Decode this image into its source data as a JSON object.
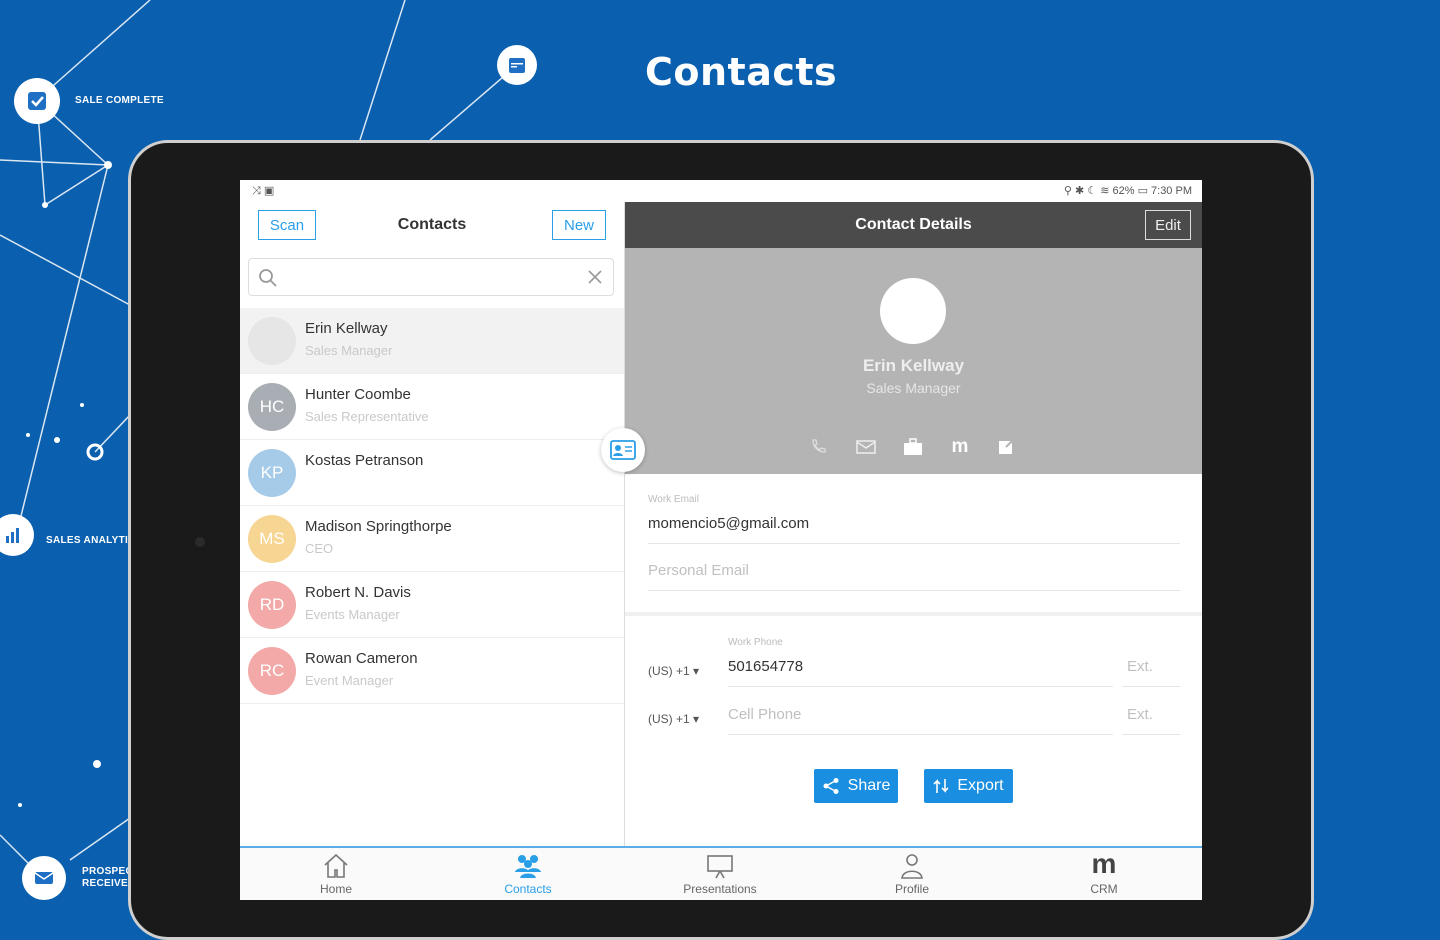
{
  "hero": {
    "title": "Contacts"
  },
  "nodes": [
    {
      "label": "SALE COMPLETE"
    },
    {
      "label": "SALES ANALYTI"
    },
    {
      "label": "PROSPEC RECEIVE"
    }
  ],
  "status_bar": {
    "left": "⤨ ▣",
    "right": "⚲ ✱ ☾ ≋ 62% ▭ 7:30 PM"
  },
  "left_panel": {
    "scan_label": "Scan",
    "title": "Contacts",
    "new_label": "New",
    "search": {
      "placeholder": "",
      "value": ""
    },
    "contacts": [
      {
        "initials": "",
        "name": "Erin Kellway",
        "role": "Sales Manager",
        "color": "#e6e6e6",
        "selected": true
      },
      {
        "initials": "HC",
        "name": "Hunter Coombe",
        "role": "Sales Representative",
        "color": "#a9adb4"
      },
      {
        "initials": "KP",
        "name": "Kostas Petranson",
        "role": "",
        "color": "#a6cbe8"
      },
      {
        "initials": "MS",
        "name": "Madison Springthorpe",
        "role": "CEO",
        "color": "#f7d592"
      },
      {
        "initials": "RD",
        "name": "Robert N. Davis",
        "role": "Events Manager",
        "color": "#f2a9a8"
      },
      {
        "initials": "RC",
        "name": "Rowan Cameron",
        "role": "Event Manager",
        "color": "#f2a9a8"
      }
    ]
  },
  "right_panel": {
    "title": "Contact Details",
    "edit_label": "Edit",
    "profile": {
      "name": "Erin Kellway",
      "role": "Sales Manager"
    },
    "work_email_label": "Work Email",
    "work_email": "momencio5@gmail.com",
    "personal_email_placeholder": "Personal Email",
    "work_phone_label": "Work Phone",
    "country_code_1": "(US) +1 ▾",
    "work_phone": "501654778",
    "ext_1": "Ext.",
    "country_code_2": "(US) +1 ▾",
    "cell_phone_placeholder": "Cell Phone",
    "ext_2": "Ext.",
    "share_label": "Share",
    "export_label": "Export"
  },
  "bottom_nav": [
    {
      "label": "Home",
      "icon": "home-icon",
      "active": false
    },
    {
      "label": "Contacts",
      "icon": "contacts-icon",
      "active": true
    },
    {
      "label": "Presentations",
      "icon": "presentation-icon",
      "active": false
    },
    {
      "label": "Profile",
      "icon": "profile-icon",
      "active": false
    },
    {
      "label": "CRM",
      "icon": "crm-icon",
      "active": false
    }
  ],
  "colors": {
    "background": "#0a5fae",
    "accent": "#2a9fe8",
    "header_dark": "#4b4b4b",
    "profile_bg": "#b4b4b4"
  }
}
